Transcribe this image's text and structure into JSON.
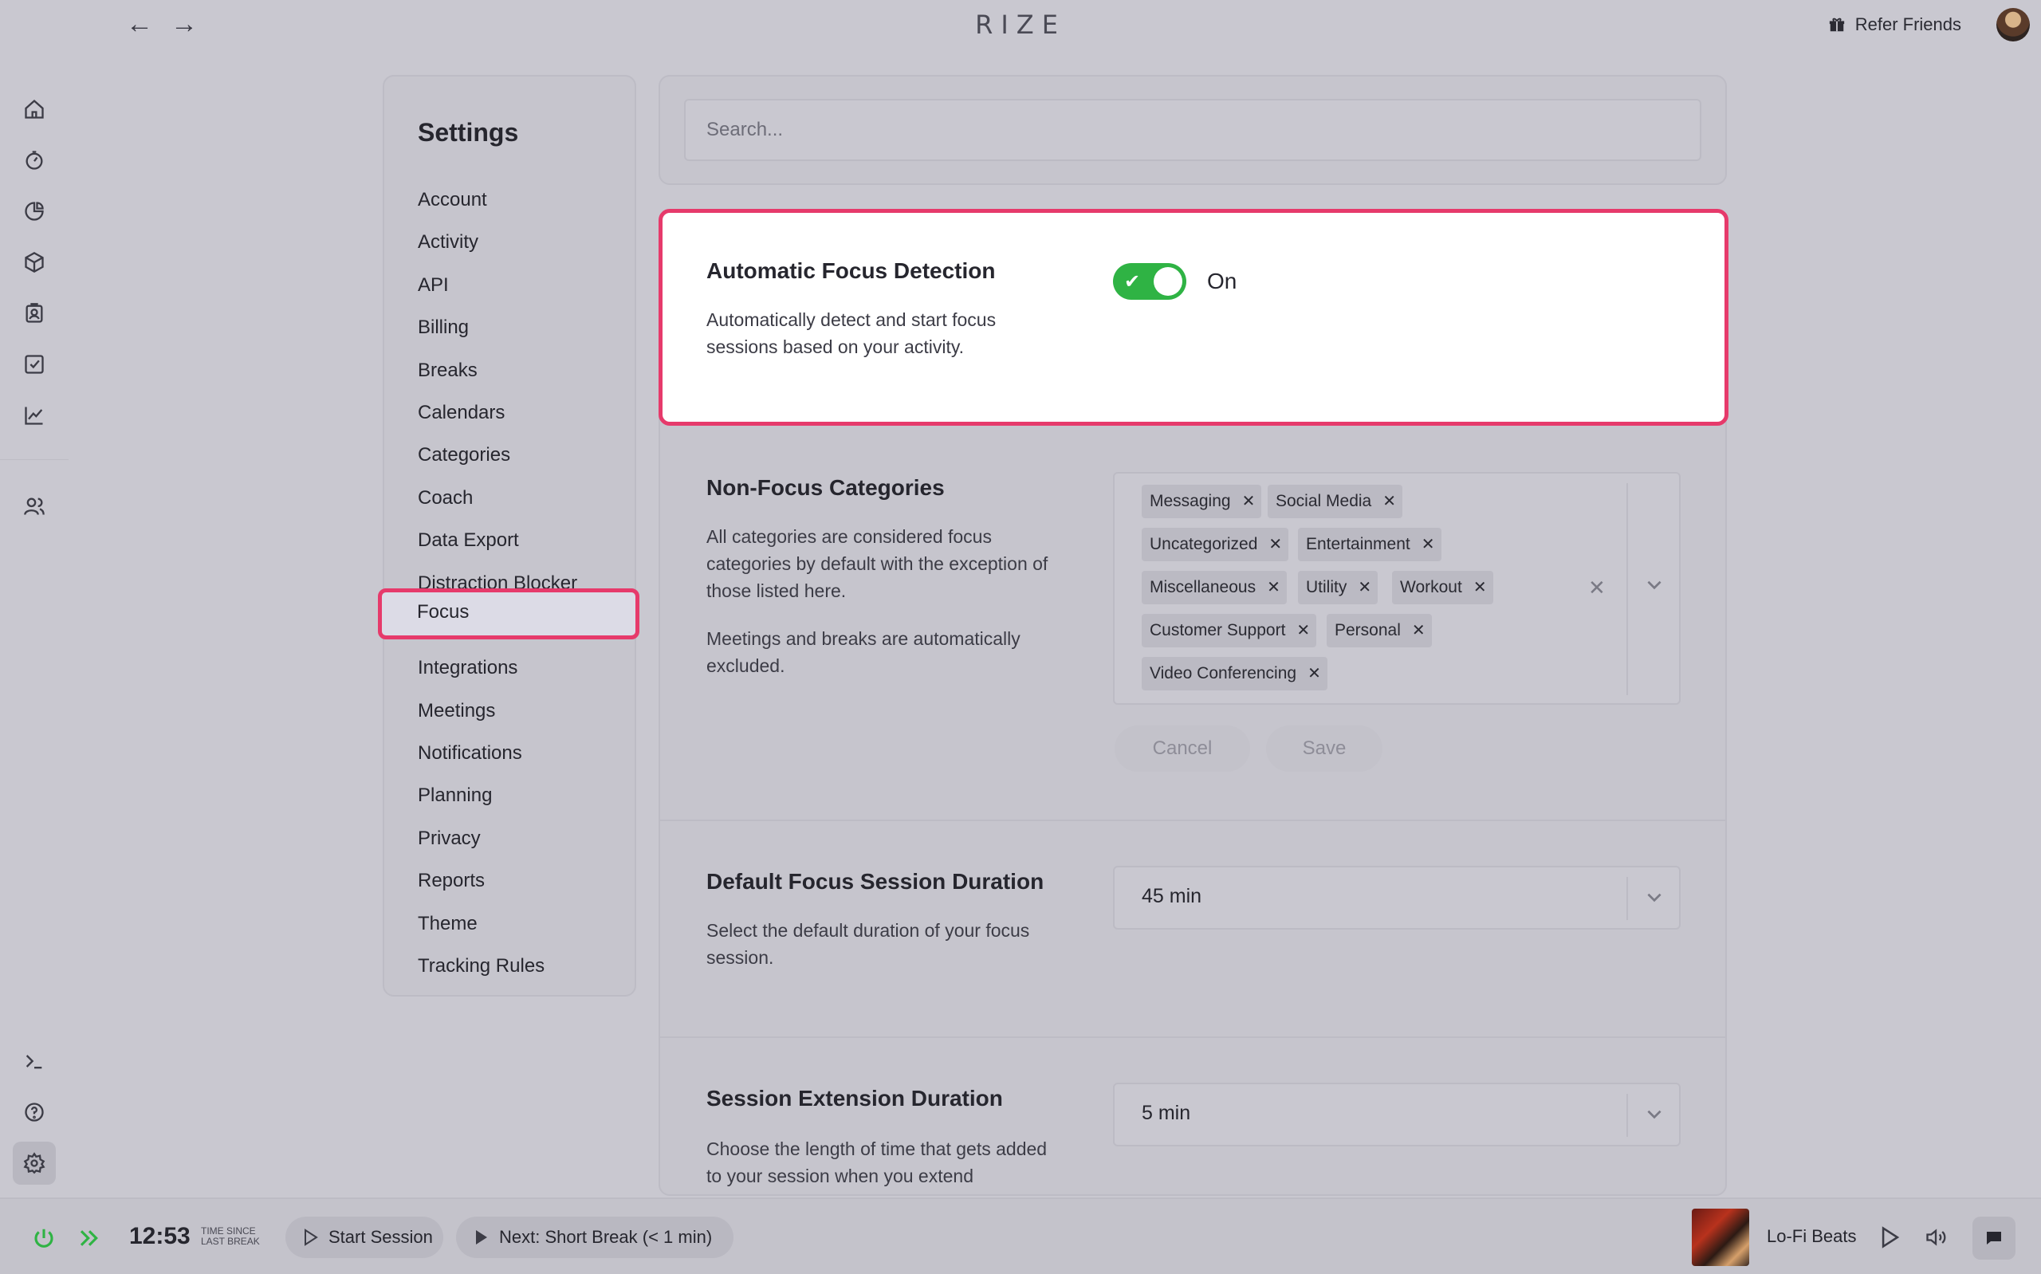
{
  "app": {
    "logo": "RIZE",
    "refer_label": "Refer Friends"
  },
  "rail": {
    "icons": [
      "home-icon",
      "timer-icon",
      "pie-chart-icon",
      "cube-icon",
      "badge-icon",
      "checkbox-icon",
      "line-chart-icon",
      "users-icon",
      "terminal-icon",
      "help-icon",
      "settings-icon"
    ]
  },
  "settings": {
    "title": "Settings",
    "items": [
      "Account",
      "Activity",
      "API",
      "Billing",
      "Breaks",
      "Calendars",
      "Categories",
      "Coach",
      "Data Export",
      "Distraction Blocker",
      "Focus",
      "Integrations",
      "Meetings",
      "Notifications",
      "Planning",
      "Privacy",
      "Reports",
      "Theme",
      "Tracking Rules"
    ],
    "selected": "Focus"
  },
  "search": {
    "placeholder": "Search..."
  },
  "afd": {
    "title": "Automatic Focus Detection",
    "description": "Automatically detect and start focus sessions based on your activity.",
    "toggle_state": "On"
  },
  "nfc": {
    "title": "Non-Focus Categories",
    "description1": "All categories are considered focus categories by default with the exception of those listed here.",
    "description2": "Meetings and breaks are automatically excluded.",
    "chips": [
      "Messaging",
      "Social Media",
      "Uncategorized",
      "Entertainment",
      "Miscellaneous",
      "Utility",
      "Workout",
      "Customer Support",
      "Personal",
      "Video Conferencing"
    ],
    "cancel_label": "Cancel",
    "save_label": "Save"
  },
  "dfsd": {
    "title": "Default Focus Session Duration",
    "description": "Select the default duration of your focus session.",
    "value": "45 min"
  },
  "sed": {
    "title": "Session Extension Duration",
    "description": "Choose the length of time that gets added to your session when you extend",
    "value": "5 min"
  },
  "bottom": {
    "timer": "12:53",
    "timer_caption_1": "TIME SINCE",
    "timer_caption_2": "LAST BREAK",
    "start_session": "Start Session",
    "next_break": "Next: Short Break (< 1 min)",
    "track": "Lo-Fi Beats"
  },
  "colors": {
    "accent_highlight": "#e63a6b",
    "toggle_on": "#2fb344"
  }
}
